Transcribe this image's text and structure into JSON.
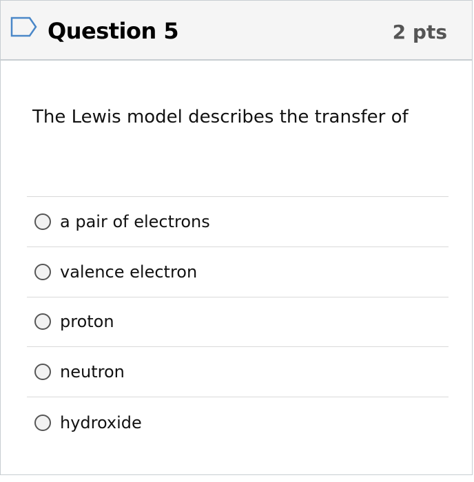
{
  "header": {
    "title": "Question 5",
    "points": "2 pts",
    "flag_icon": "bookmark-flag-icon"
  },
  "question": {
    "text": "The Lewis model describes the transfer of"
  },
  "answers": [
    {
      "label": "a pair of electrons",
      "selected": false
    },
    {
      "label": "valence electron",
      "selected": false
    },
    {
      "label": "proton",
      "selected": false
    },
    {
      "label": "neutron",
      "selected": false
    },
    {
      "label": "hydroxide",
      "selected": false
    }
  ],
  "colors": {
    "header_bg": "#f5f5f5",
    "border": "#c7cdd1",
    "flag_stroke": "#4a87c8",
    "divider": "#d9d9d9"
  }
}
